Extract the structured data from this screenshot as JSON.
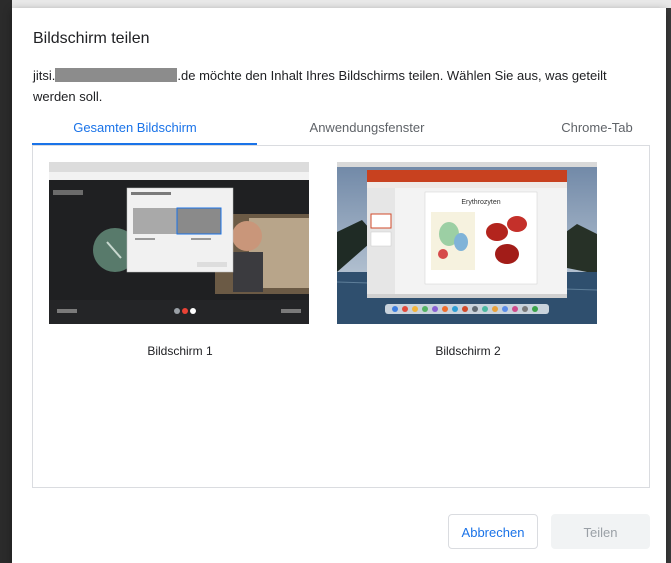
{
  "dialog": {
    "title": "Bildschirm teilen",
    "desc_prefix": "jitsi.",
    "desc_suffix": ".de möchte den Inhalt Ihres Bildschirms teilen. Wählen Sie aus, was geteilt werden soll."
  },
  "tabs": [
    {
      "label": "Gesamten Bildschirm",
      "active": true
    },
    {
      "label": "Anwendungsfenster",
      "active": false
    },
    {
      "label": "Chrome-Tab",
      "active": false
    }
  ],
  "screens": [
    {
      "label": "Bildschirm 1"
    },
    {
      "label": "Bildschirm 2"
    }
  ],
  "slide": {
    "title": "Erythrozyten"
  },
  "buttons": {
    "cancel": "Abbrechen",
    "share": "Teilen"
  },
  "colors": {
    "accent": "#1a73e8",
    "text": "#202124",
    "muted": "#5f6368",
    "border": "#dadce0"
  }
}
